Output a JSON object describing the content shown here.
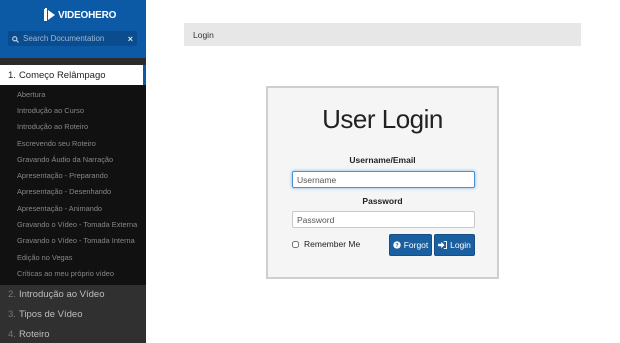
{
  "sidebar": {
    "logo_text": "VIDEOHERO",
    "search_placeholder": "Search Documentation",
    "clear_icon": "×",
    "chapters": [
      {
        "num": "1.",
        "label": "Começo Relâmpago",
        "items": [
          "Abertura",
          "Introdução ao Curso",
          "Introdução ao Roteiro",
          "Escrevendo seu Roteiro",
          "Gravando Áudio da Narração",
          "Apresentação - Preparando",
          "Apresentação - Desenhando",
          "Apresentação - Animando",
          "Gravando o Vídeo - Tomada Externa",
          "Gravando o Vídeo - Tomada Interna",
          "Edição no Vegas",
          "Críticas ao meu próprio vídeo"
        ]
      },
      {
        "num": "2.",
        "label": "Introdução ao Vídeo"
      },
      {
        "num": "3.",
        "label": "Tipos de Vídeo"
      },
      {
        "num": "4.",
        "label": "Roteiro"
      }
    ]
  },
  "breadcrumb": {
    "label": "Login"
  },
  "login": {
    "title": "User Login",
    "username_label": "Username/Email",
    "username_placeholder": "Username",
    "password_label": "Password",
    "password_placeholder": "Password",
    "remember_label": "Remember Me",
    "forgot_label": "Forgot",
    "login_label": "Login",
    "forgot_icon": "question-circle-icon",
    "login_icon": "sign-in-icon"
  },
  "colors": {
    "brand_blue": "#0c5aa6",
    "button_blue": "#1a5fa0",
    "sidebar_dark": "#2b2b2b",
    "sub_list_bg": "#111111"
  }
}
